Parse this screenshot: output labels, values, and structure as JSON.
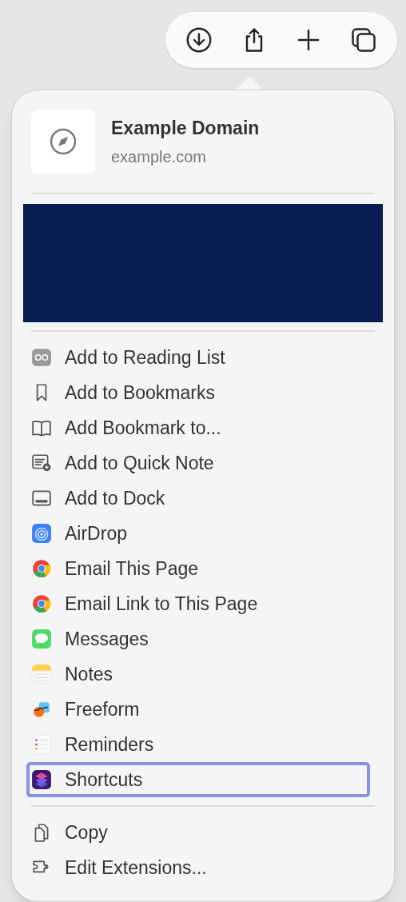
{
  "page": {
    "title": "Example Domain",
    "url": "example.com"
  },
  "sections": [
    {
      "items": [
        {
          "label": "Add to Reading List",
          "selected": false
        },
        {
          "label": "Add to Bookmarks",
          "selected": false
        },
        {
          "label": "Add Bookmark to...",
          "selected": false
        },
        {
          "label": "Add to Quick Note",
          "selected": false
        },
        {
          "label": "Add to Dock",
          "selected": false
        },
        {
          "label": "AirDrop",
          "selected": false
        },
        {
          "label": "Email This Page",
          "selected": false
        },
        {
          "label": "Email Link to This Page",
          "selected": false
        },
        {
          "label": "Messages",
          "selected": false
        },
        {
          "label": "Notes",
          "selected": false
        },
        {
          "label": "Freeform",
          "selected": false
        },
        {
          "label": "Reminders",
          "selected": false
        },
        {
          "label": "Shortcuts",
          "selected": true
        }
      ]
    },
    {
      "items": [
        {
          "label": "Copy",
          "selected": false
        },
        {
          "label": "Edit Extensions...",
          "selected": false
        }
      ]
    }
  ]
}
